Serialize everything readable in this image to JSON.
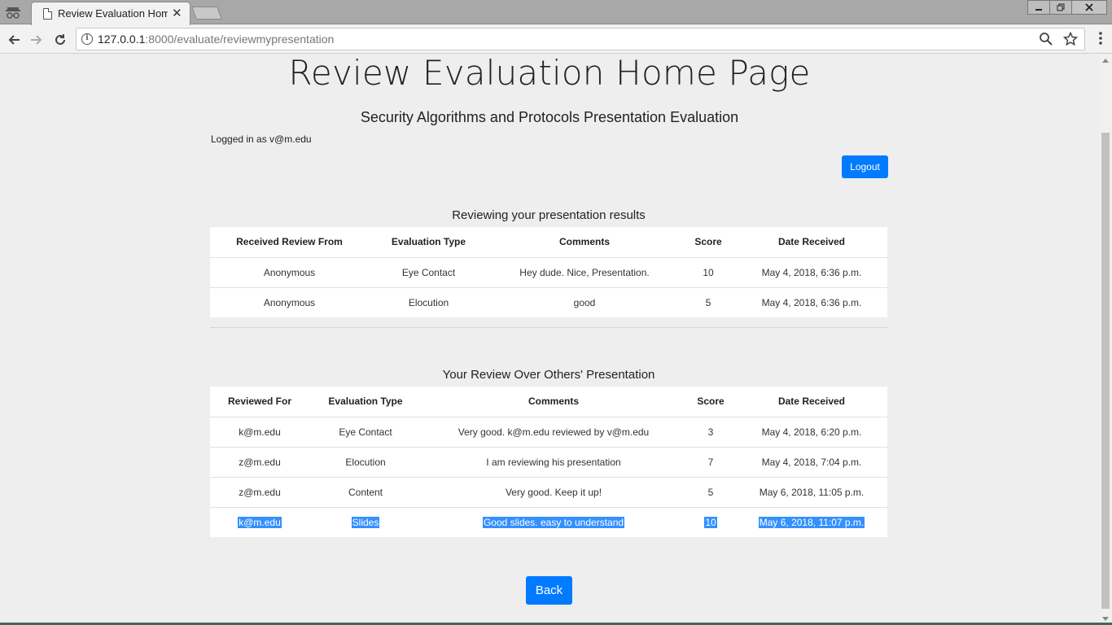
{
  "browser": {
    "tab_title": "Review Evaluation Home",
    "url_host": "127.0.0.1",
    "url_rest": ":8000/evaluate/reviewmypresentation"
  },
  "page": {
    "title": "Review Evaluation Home Page",
    "subtitle": "Security Algorithms and Protocols Presentation Evaluation",
    "logged_in": "Logged in as v@m.edu",
    "logout_label": "Logout",
    "back_label": "Back",
    "button_color": "#007bff"
  },
  "received": {
    "title": "Reviewing your presentation results",
    "headers": [
      "Received Review From",
      "Evaluation Type",
      "Comments",
      "Score",
      "Date Received"
    ],
    "rows": [
      [
        "Anonymous",
        "Eye Contact",
        "Hey dude. Nice, Presentation.",
        "10",
        "May 4, 2018, 6:36 p.m."
      ],
      [
        "Anonymous",
        "Elocution",
        "good",
        "5",
        "May 4, 2018, 6:36 p.m."
      ]
    ]
  },
  "given": {
    "title": "Your Review Over Others' Presentation",
    "headers": [
      "Reviewed For",
      "Evaluation Type",
      "Comments",
      "Score",
      "Date Received"
    ],
    "rows": [
      [
        "k@m.edu",
        "Eye Contact",
        "Very good. k@m.edu reviewed by v@m.edu",
        "3",
        "May 4, 2018, 6:20 p.m."
      ],
      [
        "z@m.edu",
        "Elocution",
        "I am reviewing his presentation",
        "7",
        "May 4, 2018, 7:04 p.m."
      ],
      [
        "z@m.edu",
        "Content",
        "Very good. Keep it up!",
        "5",
        "May 6, 2018, 11:05 p.m."
      ],
      [
        "k@m.edu",
        "Slides",
        "Good slides. easy to understand",
        "10",
        "May 6, 2018, 11:07 p.m."
      ]
    ]
  }
}
